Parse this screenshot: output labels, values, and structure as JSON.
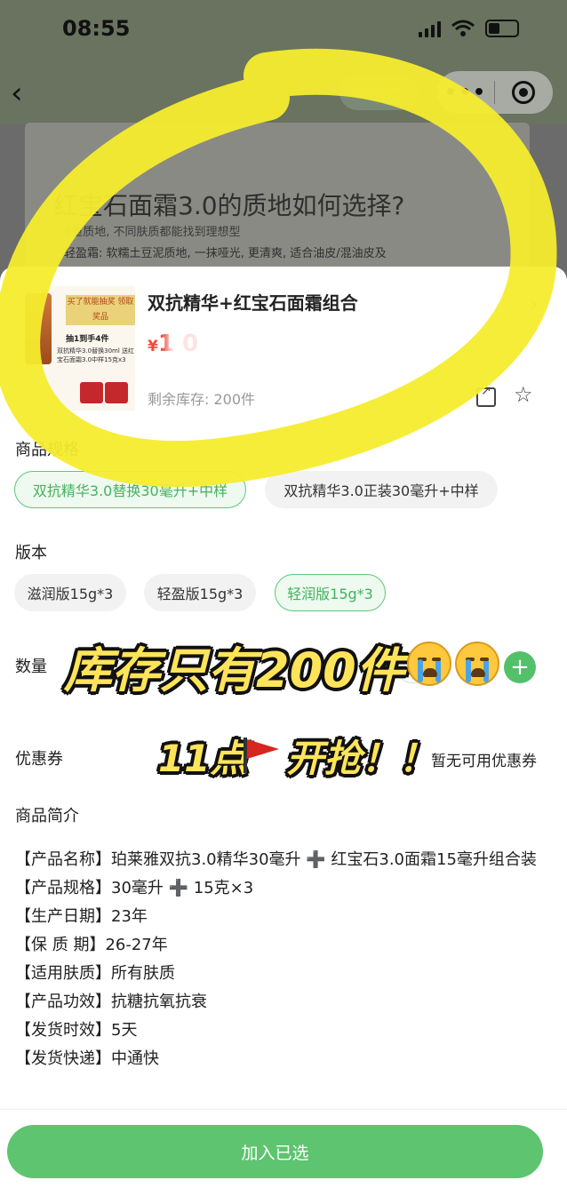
{
  "status_bar": {
    "time": "08:55"
  },
  "nav": {
    "share_label": "分享",
    "more_label": "•••"
  },
  "background_page": {
    "title": "红宝石面霜3.0的质地如何选择?",
    "line1": "3重质地, 不同肤质都能找到理想型",
    "line2": "轻盈霜: 软糯土豆泥质地, 一抹哑光, 更清爽, 适合油皮/混油皮及"
  },
  "product": {
    "name": "双抗精华+红宝石面霜组合",
    "currency": "¥",
    "price_visible": "1 0",
    "stock": "剩余库存: 200件",
    "thumb_header": "买了就能抽奖 领取奖品",
    "thumb_line1": "抽1到手4件",
    "thumb_line2": "双抗精华3.0替换30ml 送红宝石面霜3.0中样15克x3"
  },
  "spec": {
    "label": "商品规格",
    "options": [
      {
        "label": "双抗精华3.0替换30毫升+中样",
        "selected": true
      },
      {
        "label": "双抗精华3.0正装30毫升+中样",
        "selected": false
      }
    ]
  },
  "version": {
    "label": "版本",
    "options": [
      {
        "label": "滋润版15g*3",
        "selected": false
      },
      {
        "label": "轻盈版15g*3",
        "selected": false
      },
      {
        "label": "轻润版15g*3",
        "selected": true
      }
    ]
  },
  "quantity": {
    "label": "数量",
    "plus": "+"
  },
  "coupon": {
    "label": "优惠券",
    "value": "暂无可用优惠券"
  },
  "intro": {
    "label": "商品简介",
    "lines": [
      "【产品名称】珀莱雅双抗3.0精华30毫升 ➕ 红宝石3.0面霜15毫升组合装",
      "【产品规格】30毫升 ➕ 15克×3",
      "【生产日期】23年",
      "【保 质 期】26-27年",
      "【适用肤质】所有肤质",
      "【产品功效】抗糖抗氧抗衰",
      "【发货时效】5天",
      "【发货快递】中通快"
    ]
  },
  "actions": {
    "add_label": "加入已选"
  },
  "overlay": {
    "sticker1": "库存只有200件",
    "sticker2a": "11点",
    "sticker2b": "开抢！！"
  },
  "colors": {
    "accent": "#5ec46f",
    "price": "#f04b3a",
    "highlight": "#f5ec2e"
  }
}
